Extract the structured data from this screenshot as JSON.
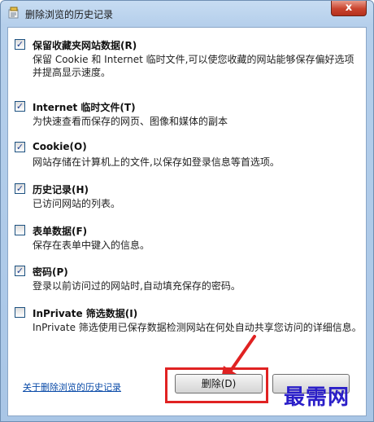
{
  "window": {
    "title": "删除浏览的历史记录",
    "close_label": "x"
  },
  "options": [
    {
      "checked": true,
      "title": "保留收藏夹网站数据(R)",
      "desc": "保留 Cookie 和 Internet 临时文件,可以使您收藏的网站能够保存偏好选项并提高显示速度。"
    },
    {
      "checked": true,
      "title": "Internet 临时文件(T)",
      "desc": "为快速查看而保存的网页、图像和媒体的副本"
    },
    {
      "checked": true,
      "title": "Cookie(O)",
      "desc": "网站存储在计算机上的文件,以保存如登录信息等首选项。"
    },
    {
      "checked": true,
      "title": "历史记录(H)",
      "desc": "已访问网站的列表。"
    },
    {
      "checked": false,
      "title": "表单数据(F)",
      "desc": "保存在表单中键入的信息。"
    },
    {
      "checked": true,
      "title": "密码(P)",
      "desc": "登录以前访问过的网站时,自动填充保存的密码。"
    },
    {
      "checked": false,
      "title": "InPrivate 筛选数据(I)",
      "desc": "InPrivate 筛选使用已保存数据检测网站在何处自动共享您访问的详细信息。"
    }
  ],
  "footer": {
    "about_link": "关于删除浏览的历史记录",
    "delete_label": "删除(D)",
    "cancel_label": ""
  },
  "watermark": "最需网",
  "colors": {
    "highlight": "#e02222",
    "watermark": "#2a1ec8",
    "link": "#0a4ba8"
  }
}
